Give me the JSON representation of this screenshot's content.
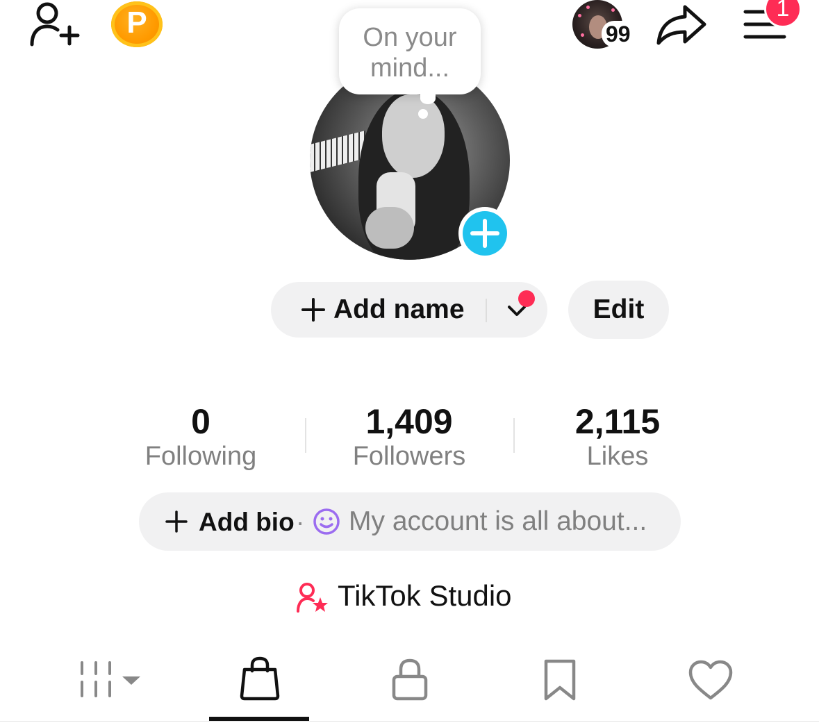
{
  "top_bar": {
    "add_friend_icon": "person-plus-icon",
    "coin_letter": "P",
    "mini_avatar_count": "99",
    "share_icon": "share-arrow-icon",
    "menu_icon": "hamburger-menu-icon",
    "menu_badge": "1"
  },
  "avatar": {
    "bubble_text_line1": "On your",
    "bubble_text_line2": "mind...",
    "add_photo_icon": "plus-icon",
    "accent_color": "#20c3ee"
  },
  "profile_actions": {
    "add_name_label": "Add name",
    "edit_label": "Edit",
    "notification_dot_color": "#fe2c55"
  },
  "stats": [
    {
      "value": "0",
      "label": "Following"
    },
    {
      "value": "1,409",
      "label": "Followers"
    },
    {
      "value": "2,115",
      "label": "Likes"
    }
  ],
  "bio": {
    "add_label": "Add bio",
    "separator": "·",
    "placeholder": "My account is all about..."
  },
  "studio": {
    "label": "TikTok Studio",
    "icon_color": "#fe2c55"
  },
  "tabs": [
    {
      "icon": "grid-videos-icon",
      "selected": false
    },
    {
      "icon": "shopping-bag-icon",
      "selected": true
    },
    {
      "icon": "lock-icon",
      "selected": false
    },
    {
      "icon": "bookmark-icon",
      "selected": false
    },
    {
      "icon": "heart-icon",
      "selected": false
    }
  ]
}
